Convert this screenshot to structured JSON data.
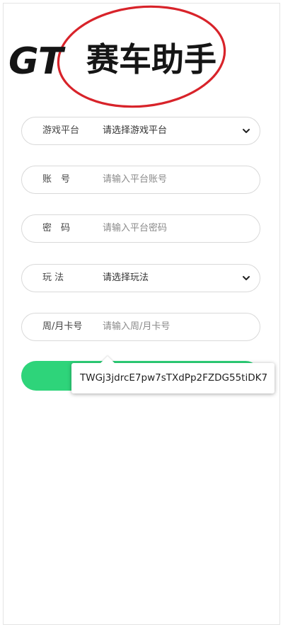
{
  "logo": {
    "brand_latin": "GT",
    "brand_cn": "赛车助手"
  },
  "form": {
    "game_platform": {
      "label": "游戏平台",
      "value": "请选择游戏平台"
    },
    "account": {
      "label": "账　号",
      "placeholder": "请输入平台账号"
    },
    "password": {
      "label": "密　码",
      "placeholder": "请输入平台密码"
    },
    "play_mode": {
      "label": "玩 法",
      "value": "请选择玩法"
    },
    "card": {
      "label": "周/月卡号",
      "placeholder": "请输入周/月卡号"
    }
  },
  "submit": {
    "label": ""
  },
  "tooltip": {
    "text": "TWGj3jdrcE7pw7sTXdPp2FZDG55tiDK7"
  },
  "colors": {
    "accent_green": "#2ed47a",
    "logo_red": "#d8232a",
    "logo_black": "#1a1a1a"
  },
  "icons": {
    "select_chevron": "chevron-down-icon"
  }
}
